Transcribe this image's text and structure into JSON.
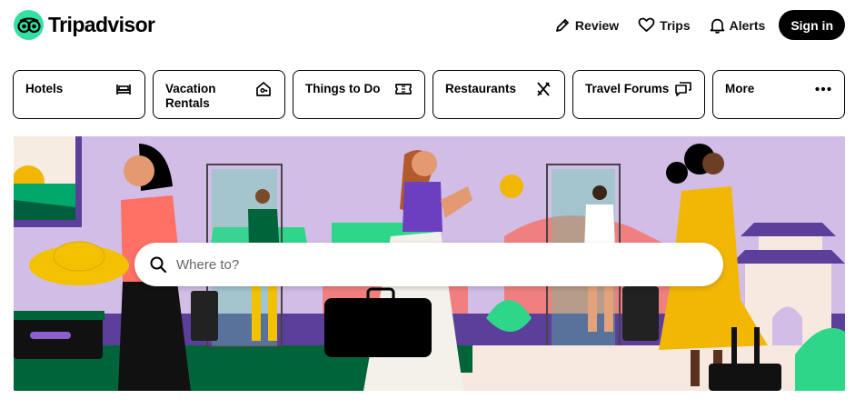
{
  "brand": {
    "name": "Tripadvisor",
    "accent": "#34e0a1"
  },
  "nav": {
    "review": "Review",
    "trips": "Trips",
    "alerts": "Alerts",
    "sign_in": "Sign in"
  },
  "categories": [
    {
      "label": "Hotels",
      "icon": "bed-icon"
    },
    {
      "label": "Vacation Rentals",
      "icon": "house-icon"
    },
    {
      "label": "Things to Do",
      "icon": "ticket-icon"
    },
    {
      "label": "Restaurants",
      "icon": "fork-knife-icon"
    },
    {
      "label": "Travel Forums",
      "icon": "chat-bubbles-icon"
    },
    {
      "label": "More",
      "icon": "more-dots-icon"
    }
  ],
  "search": {
    "placeholder": "Where to?",
    "value": ""
  },
  "hero": {
    "background": "#d2bde6"
  }
}
